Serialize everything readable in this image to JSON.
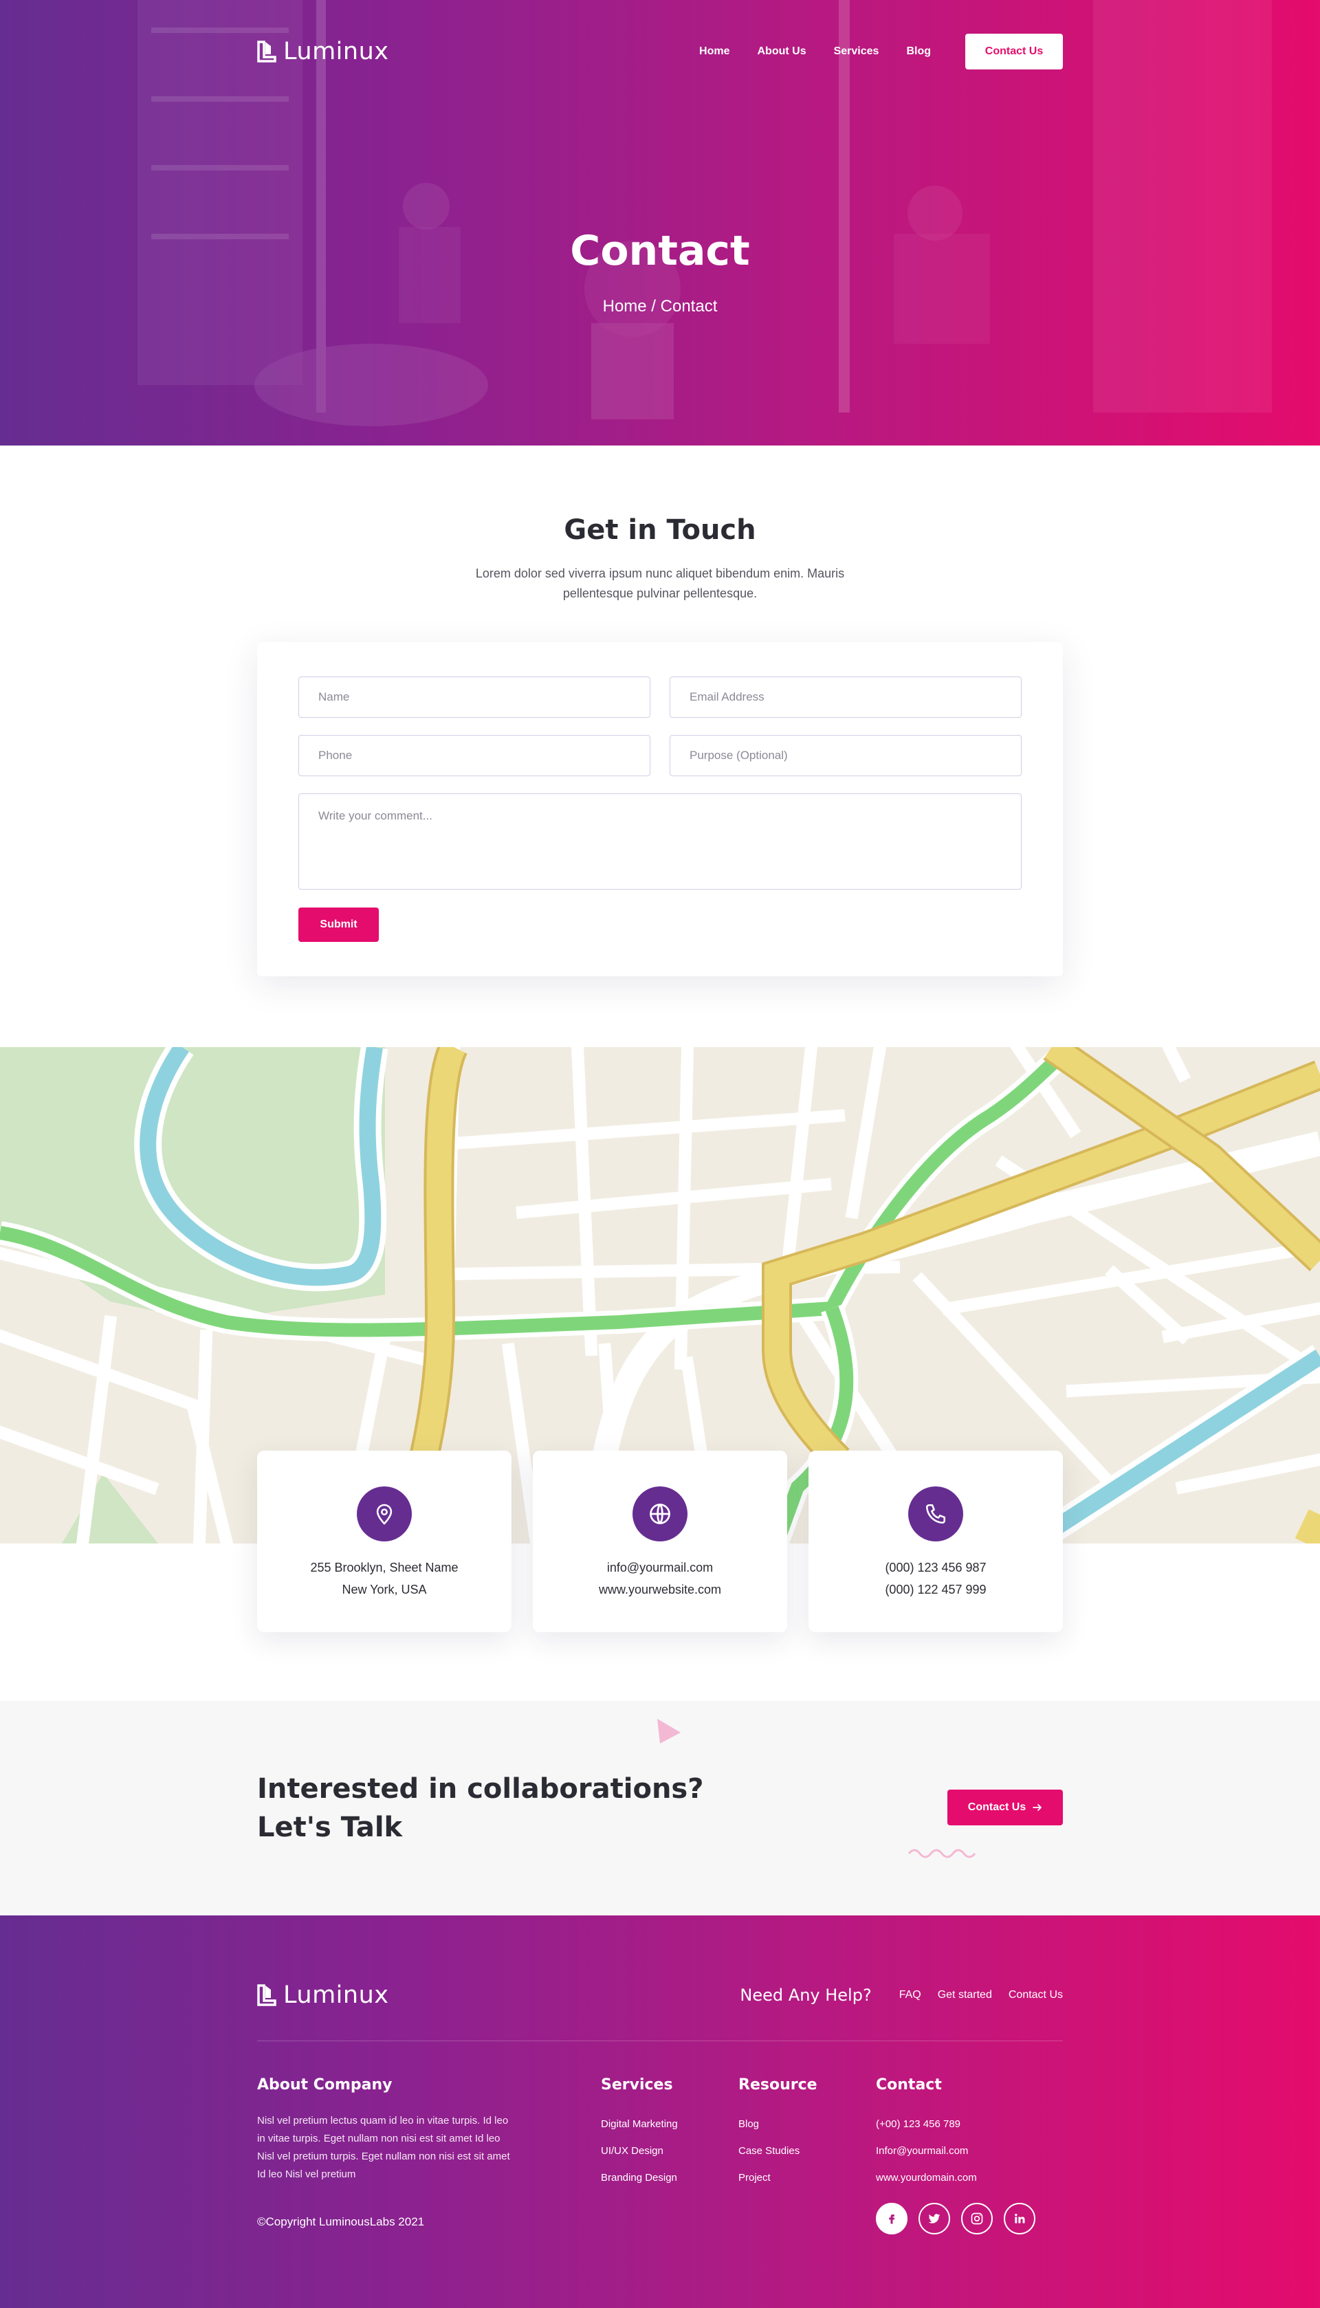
{
  "brand": {
    "name": "Luminux"
  },
  "nav": {
    "items": [
      {
        "label": "Home"
      },
      {
        "label": "About Us"
      },
      {
        "label": "Services"
      },
      {
        "label": "Blog"
      }
    ],
    "cta_label": "Contact Us"
  },
  "hero": {
    "title": "Contact",
    "breadcrumb": {
      "home": "Home",
      "separator": " / ",
      "current": "Contact"
    }
  },
  "get_in_touch": {
    "title": "Get in Touch",
    "subtitle": "Lorem dolor sed viverra ipsum nunc aliquet bibendum enim. Mauris pellentesque pulvinar pellentesque."
  },
  "form": {
    "name_placeholder": "Name",
    "email_placeholder": "Email Address",
    "phone_placeholder": "Phone",
    "purpose_placeholder": "Purpose (Optional)",
    "comment_placeholder": "Write your comment...",
    "submit_label": "Submit"
  },
  "info_cards": [
    {
      "icon": "location-pin-icon",
      "lines": [
        "255 Brooklyn, Sheet Name",
        "New York, USA"
      ]
    },
    {
      "icon": "globe-icon",
      "lines": [
        "info@yourmail.com",
        "www.yourwebsite.com"
      ]
    },
    {
      "icon": "phone-icon",
      "lines": [
        "(000) 123 456 987",
        "(000) 122 457 999"
      ]
    }
  ],
  "cta": {
    "line1": "Interested in collaborations?",
    "line2": "Let's Talk",
    "button_label": "Contact Us"
  },
  "footer": {
    "help_title": "Need Any Help?",
    "help_links": [
      "FAQ",
      "Get started",
      "Contact Us"
    ],
    "about_title": "About Company",
    "about_text": "Nisl vel pretium lectus quam id leo in vitae turpis. Id leo in vitae turpis. Eget nullam non nisi est sit amet Id leo Nisl vel pretium turpis. Eget nullam non nisi est sit amet Id leo Nisl vel pretium",
    "services_title": "Services",
    "services": [
      "Digital Marketing",
      "UI/UX Design",
      "Branding Design"
    ],
    "resource_title": "Resource",
    "resources": [
      "Blog",
      "Case Studies",
      "Project"
    ],
    "contact_title": "Contact",
    "contact": [
      "(+00) 123 456 789",
      "Infor@yourmail.com",
      "www.yourdomain.com"
    ],
    "copyright": "©Copyright LuminousLabs 2021",
    "social": [
      "facebook-icon",
      "twitter-icon",
      "instagram-icon",
      "linkedin-icon"
    ]
  },
  "colors": {
    "primary_purple": "#662d91",
    "primary_pink": "#e40c6c",
    "text_dark": "#2b2b33"
  }
}
